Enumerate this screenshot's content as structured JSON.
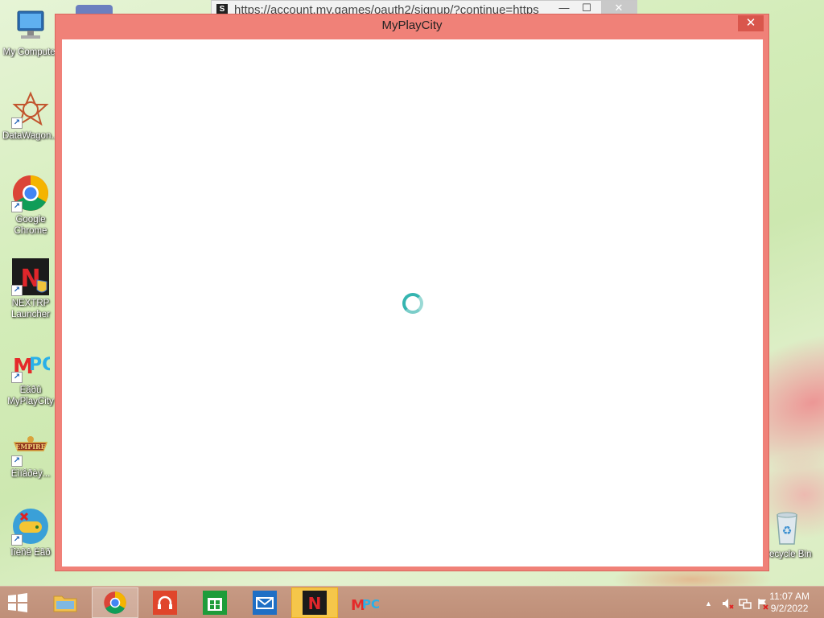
{
  "desktop": {
    "icons": [
      {
        "label": "My Computer"
      },
      {
        "label": "DataWagon..."
      },
      {
        "label": "Google Chrome"
      },
      {
        "label": "NEXTRP Launcher"
      },
      {
        "label": "Èãðû MyPlayCity"
      },
      {
        "label": "Èìïåðèÿ..."
      },
      {
        "label": "Ïîèñê Èãð"
      },
      {
        "label": "Recycle Bin"
      }
    ]
  },
  "background_window": {
    "favicon": "S",
    "url": "https://account.my.games/oauth2/signup/?continue=https",
    "minimize": "—",
    "maximize": "☐",
    "close": "✕"
  },
  "dialog": {
    "title": "MyPlayCity",
    "close": "✕",
    "state": "loading"
  },
  "taskbar": {
    "clock_time": "11:07 AM",
    "clock_date": "9/2/2022",
    "tray_chevron": "▲"
  },
  "colors": {
    "dialog_frame": "#f08178",
    "spinner": "#35b5b0",
    "taskbar": "#c79a84"
  }
}
